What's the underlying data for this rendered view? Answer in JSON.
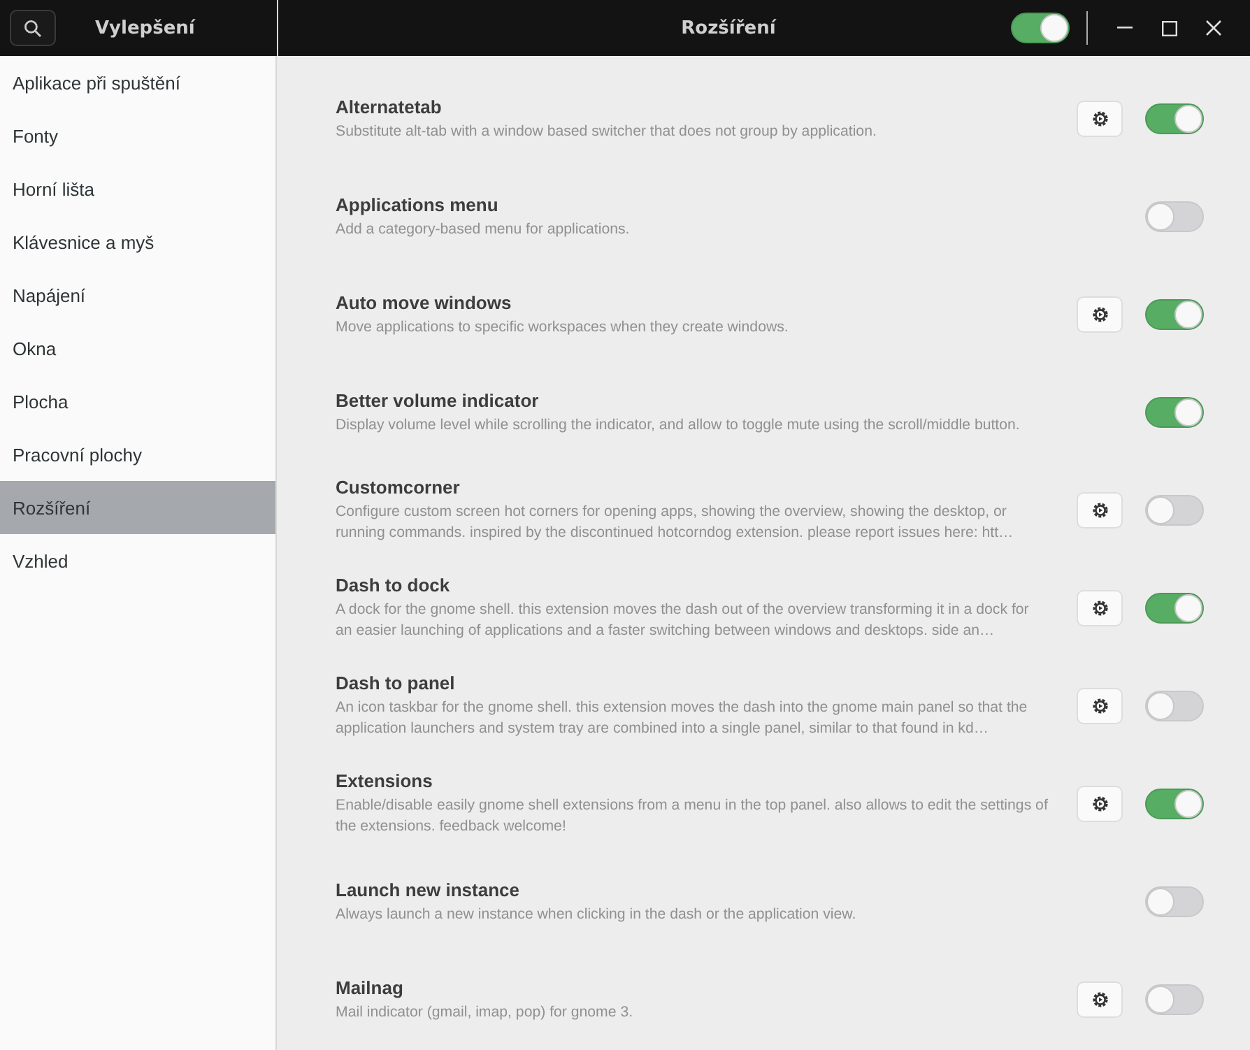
{
  "header": {
    "app_title": "Vylepšení",
    "page_title": "Rozšíření",
    "master_switch": {
      "on": true
    }
  },
  "sidebar": {
    "items": [
      {
        "label": "Aplikace při spuštění",
        "selected": false
      },
      {
        "label": "Fonty",
        "selected": false
      },
      {
        "label": "Horní lišta",
        "selected": false
      },
      {
        "label": "Klávesnice a myš",
        "selected": false
      },
      {
        "label": "Napájení",
        "selected": false
      },
      {
        "label": "Okna",
        "selected": false
      },
      {
        "label": "Plocha",
        "selected": false
      },
      {
        "label": "Pracovní plochy",
        "selected": false
      },
      {
        "label": "Rozšíření",
        "selected": true
      },
      {
        "label": "Vzhled",
        "selected": false
      }
    ]
  },
  "extensions": [
    {
      "name": "Alternatetab",
      "description": "Substitute alt-tab with a window based switcher that does not group by application.",
      "has_settings": true,
      "on": true
    },
    {
      "name": "Applications menu",
      "description": "Add a category-based menu for applications.",
      "has_settings": false,
      "on": false
    },
    {
      "name": "Auto move windows",
      "description": "Move applications to specific workspaces when they create windows.",
      "has_settings": true,
      "on": true
    },
    {
      "name": "Better volume indicator",
      "description": "Display volume level while scrolling the indicator, and allow to toggle mute using the scroll/middle button.",
      "has_settings": false,
      "on": true
    },
    {
      "name": "Customcorner",
      "description": "Configure custom screen hot corners for opening apps, showing the overview, showing the desktop, or running commands. inspired by the discontinued hotcorndog extension. please report issues here: htt…",
      "has_settings": true,
      "on": false
    },
    {
      "name": "Dash to dock",
      "description": "A dock for the gnome shell. this extension moves the dash out of the overview transforming it in a dock for an easier launching of applications and a faster switching between windows and desktops. side an…",
      "has_settings": true,
      "on": true
    },
    {
      "name": "Dash to panel",
      "description": "An icon taskbar for the gnome shell. this extension moves the dash into the gnome main panel so that the application launchers and system tray are combined into a single panel, similar to that found in kd…",
      "has_settings": true,
      "on": false
    },
    {
      "name": "Extensions",
      "description": "Enable/disable easily gnome shell extensions from a menu in the top panel. also allows to edit the settings of the extensions. feedback welcome!",
      "has_settings": true,
      "on": true
    },
    {
      "name": "Launch new instance",
      "description": "Always launch a new instance when clicking in the dash or the application view.",
      "has_settings": false,
      "on": false
    },
    {
      "name": "Mailnag",
      "description": "Mail indicator (gmail, imap, pop) for gnome 3.",
      "has_settings": true,
      "on": false
    }
  ]
}
